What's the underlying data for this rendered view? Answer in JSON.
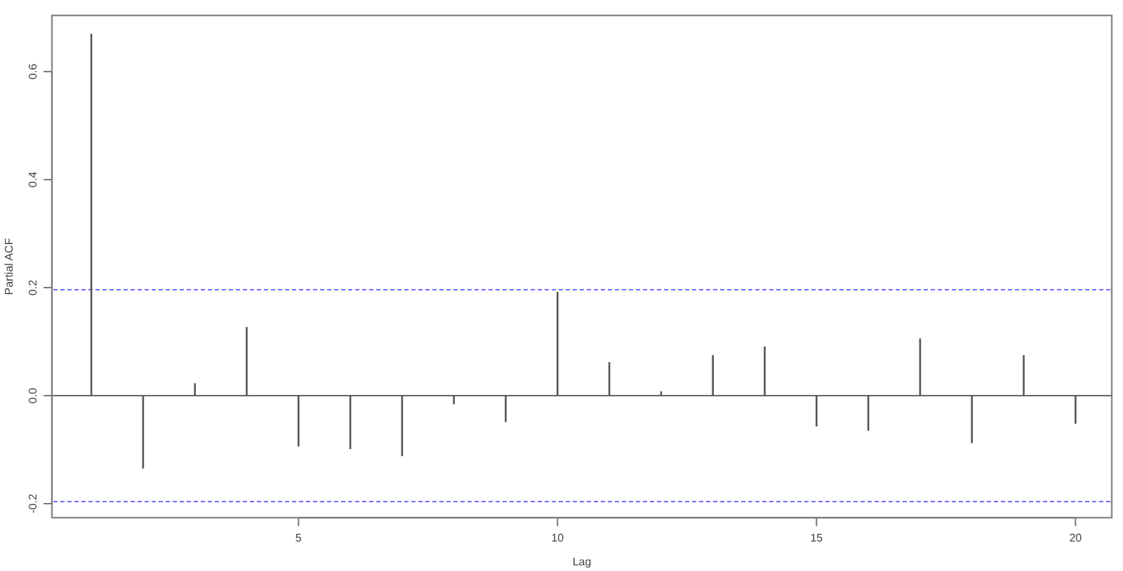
{
  "plot": {
    "chart_data": {
      "type": "bar",
      "xlabel": "Lag",
      "ylabel": "Partial ACF",
      "x": [
        1,
        2,
        3,
        4,
        5,
        6,
        7,
        8,
        9,
        10,
        11,
        12,
        13,
        14,
        15,
        16,
        17,
        18,
        19,
        20
      ],
      "values": [
        0.67,
        -0.135,
        0.023,
        0.127,
        -0.094,
        -0.099,
        -0.112,
        -0.016,
        -0.049,
        0.192,
        0.062,
        0.008,
        0.075,
        0.091,
        -0.057,
        -0.065,
        0.106,
        -0.088,
        0.075,
        -0.052
      ],
      "xlim": [
        0.24,
        20.7
      ],
      "ylim": [
        -0.226,
        0.704
      ],
      "xticks": [
        5,
        10,
        15,
        20
      ],
      "yticks": [
        {
          "value": -0.2,
          "label": "-0.2"
        },
        {
          "value": 0,
          "label": "0.0"
        },
        {
          "value": 0.2,
          "label": "0.2"
        },
        {
          "value": 0.4,
          "label": "0.4"
        },
        {
          "value": 0.6,
          "label": "0.6"
        }
      ],
      "ref_lines": [
        {
          "axis": "y",
          "value": 0.196
        },
        {
          "axis": "y",
          "value": -0.196
        }
      ]
    }
  }
}
